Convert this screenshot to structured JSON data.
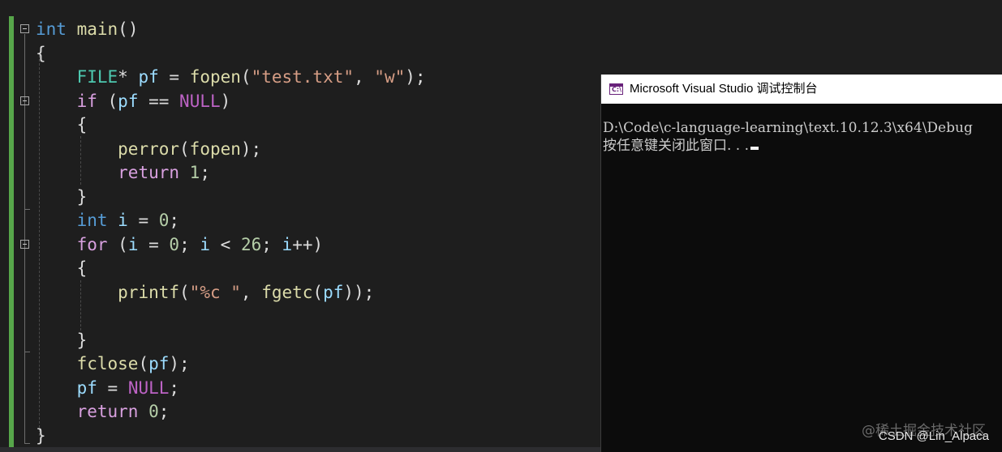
{
  "editor": {
    "lines": [
      [
        {
          "t": "int",
          "c": "kw"
        },
        {
          "t": " "
        },
        {
          "t": "main",
          "c": "fn"
        },
        {
          "t": "()"
        }
      ],
      [
        {
          "t": "{"
        }
      ],
      [
        {
          "t": "    "
        },
        {
          "t": "FILE",
          "c": "ty"
        },
        {
          "t": "* "
        },
        {
          "t": "pf",
          "c": "var"
        },
        {
          "t": " = "
        },
        {
          "t": "fopen",
          "c": "fn"
        },
        {
          "t": "("
        },
        {
          "t": "\"test.txt\"",
          "c": "str"
        },
        {
          "t": ", "
        },
        {
          "t": "\"w\"",
          "c": "str"
        },
        {
          "t": ");"
        }
      ],
      [
        {
          "t": "    "
        },
        {
          "t": "if",
          "c": "kw2"
        },
        {
          "t": " ("
        },
        {
          "t": "pf",
          "c": "var"
        },
        {
          "t": " == "
        },
        {
          "t": "NULL",
          "c": "mac"
        },
        {
          "t": ")"
        }
      ],
      [
        {
          "t": "    {"
        }
      ],
      [
        {
          "t": "        "
        },
        {
          "t": "perror",
          "c": "fn"
        },
        {
          "t": "("
        },
        {
          "t": "fopen",
          "c": "fn"
        },
        {
          "t": ");"
        }
      ],
      [
        {
          "t": "        "
        },
        {
          "t": "return",
          "c": "kw2"
        },
        {
          "t": " "
        },
        {
          "t": "1",
          "c": "num"
        },
        {
          "t": ";"
        }
      ],
      [
        {
          "t": "    }"
        }
      ],
      [
        {
          "t": "    "
        },
        {
          "t": "int",
          "c": "kw"
        },
        {
          "t": " "
        },
        {
          "t": "i",
          "c": "var"
        },
        {
          "t": " = "
        },
        {
          "t": "0",
          "c": "num"
        },
        {
          "t": ";"
        }
      ],
      [
        {
          "t": "    "
        },
        {
          "t": "for",
          "c": "kw2"
        },
        {
          "t": " ("
        },
        {
          "t": "i",
          "c": "var"
        },
        {
          "t": " = "
        },
        {
          "t": "0",
          "c": "num"
        },
        {
          "t": "; "
        },
        {
          "t": "i",
          "c": "var"
        },
        {
          "t": " < "
        },
        {
          "t": "26",
          "c": "num"
        },
        {
          "t": "; "
        },
        {
          "t": "i",
          "c": "var"
        },
        {
          "t": "++)"
        }
      ],
      [
        {
          "t": "    {"
        }
      ],
      [
        {
          "t": "        "
        },
        {
          "t": "printf",
          "c": "fn"
        },
        {
          "t": "("
        },
        {
          "t": "\"%c \"",
          "c": "str"
        },
        {
          "t": ", "
        },
        {
          "t": "fgetc",
          "c": "fn"
        },
        {
          "t": "("
        },
        {
          "t": "pf",
          "c": "var"
        },
        {
          "t": "));"
        }
      ],
      [
        {
          "t": ""
        }
      ],
      [
        {
          "t": "    }"
        }
      ],
      [
        {
          "t": "    "
        },
        {
          "t": "fclose",
          "c": "fn"
        },
        {
          "t": "("
        },
        {
          "t": "pf",
          "c": "var"
        },
        {
          "t": ");"
        }
      ],
      [
        {
          "t": "    "
        },
        {
          "t": "pf",
          "c": "var"
        },
        {
          "t": " = "
        },
        {
          "t": "NULL",
          "c": "mac"
        },
        {
          "t": ";"
        }
      ],
      [
        {
          "t": "    "
        },
        {
          "t": "return",
          "c": "kw2"
        },
        {
          "t": " "
        },
        {
          "t": "0",
          "c": "num"
        },
        {
          "t": ";"
        }
      ],
      [
        {
          "t": "}"
        }
      ]
    ]
  },
  "console": {
    "title": "Microsoft Visual Studio 调试控制台",
    "icon": "console-app-icon",
    "icon_glyph": "C:\\",
    "output_path": "D:\\Code\\c-language-learning\\text.10.12.3\\x64\\Debug",
    "press_any_key": "按任意键关闭此窗口. . ."
  },
  "watermark": {
    "site": "@稀土掘金技术社区",
    "author": "CSDN @Lin_Alpaca"
  },
  "colors": {
    "editor_bg": "#1e1e1e",
    "keyword": "#569cd6",
    "control_keyword": "#d8a0df",
    "function": "#dcdcaa",
    "type": "#4ec9b0",
    "string": "#d69d85",
    "number": "#b5cea8",
    "variable": "#9cdcfe",
    "macro": "#bd63c5",
    "change_bar": "#57a64a",
    "console_bg": "#0c0c0c"
  }
}
